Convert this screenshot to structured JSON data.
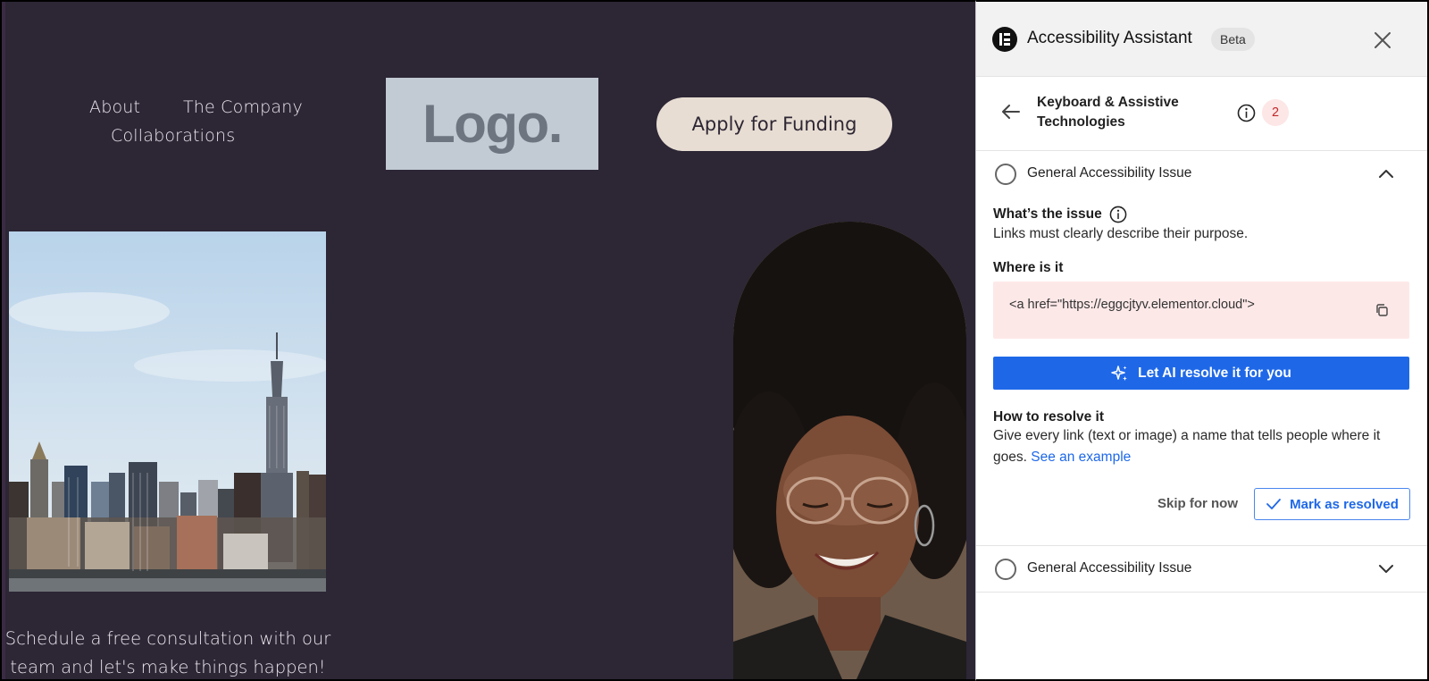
{
  "site": {
    "nav": {
      "about": "About",
      "company": "The Company",
      "collaborations": "Collaborations"
    },
    "logo_text": "Logo.",
    "cta_label": "Apply for Funding",
    "caption_line1": "Schedule a free consultation with our",
    "caption_line2": "team and let's make things happen!",
    "colors": {
      "background": "#2c2635",
      "cta": "#e7ddd3",
      "logo_bg": "#c2cad3"
    }
  },
  "panel": {
    "title": "Accessibility Assistant",
    "beta_badge": "Beta",
    "category": {
      "title_line1": "Keyboard & Assistive",
      "title_line2": "Technologies",
      "issue_count": "2"
    },
    "issues": [
      {
        "title": "General Accessibility Issue",
        "expanded": true,
        "whats_issue_label": "What’s the issue",
        "whats_issue_text": "Links must clearly describe their purpose.",
        "where_label": "Where is it",
        "code_snippet": "<a href=\"https://eggcjtyv.elementor.cloud\">",
        "ai_button": "Let AI resolve it for you",
        "how_label": "How to resolve it",
        "how_text": "Give every link (text or image) a name that tells people where it goes.",
        "example_link": "See an example",
        "skip_label": "Skip for now",
        "resolve_label": "Mark as resolved"
      },
      {
        "title": "General Accessibility Issue",
        "expanded": false
      }
    ],
    "colors": {
      "primary": "#1e68e8",
      "badge_bg": "#fde6e6",
      "badge_text": "#c0292b",
      "code_bg": "#fde8e8"
    }
  }
}
